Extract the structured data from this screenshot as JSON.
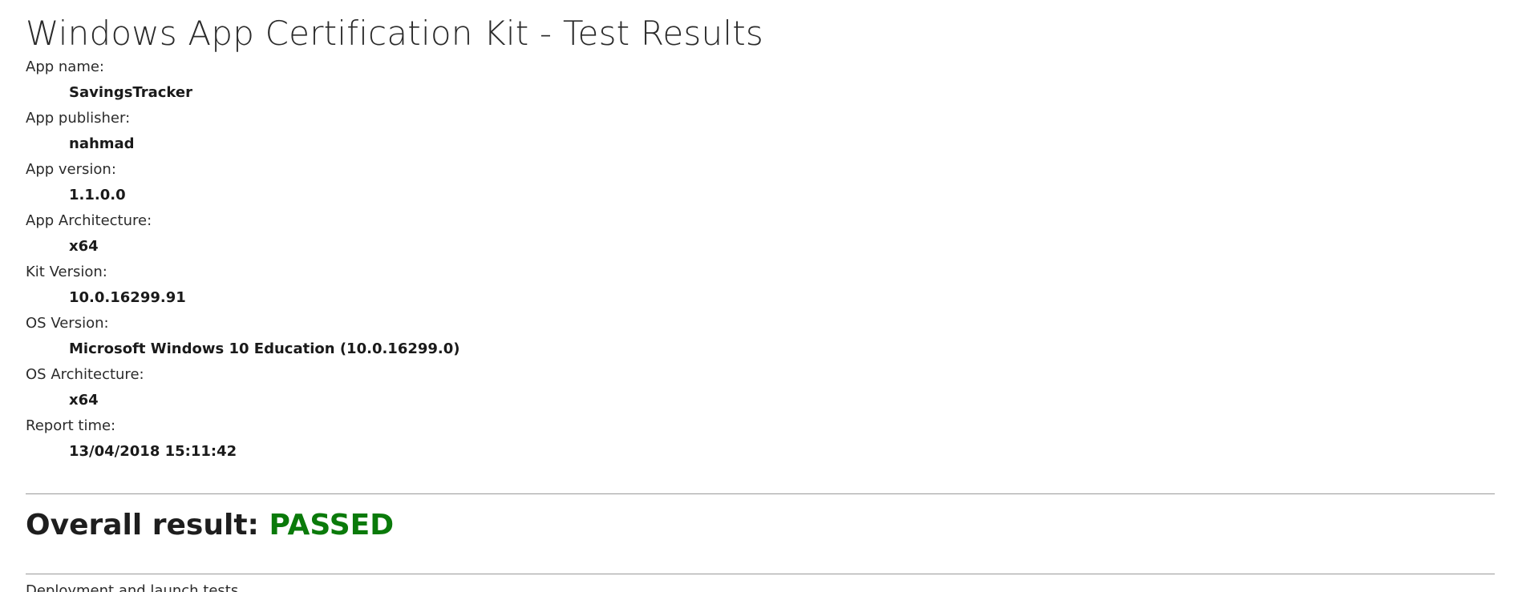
{
  "report": {
    "title": "Windows App Certification Kit - Test Results"
  },
  "details": [
    {
      "label": "App name:",
      "value": "SavingsTracker"
    },
    {
      "label": "App publisher:",
      "value": "nahmad"
    },
    {
      "label": "App version:",
      "value": "1.1.0.0"
    },
    {
      "label": "App Architecture:",
      "value": "x64"
    },
    {
      "label": "Kit Version:",
      "value": "10.0.16299.91"
    },
    {
      "label": "OS Version:",
      "value": "Microsoft Windows 10 Education (10.0.16299.0)"
    },
    {
      "label": "OS Architecture:",
      "value": "x64"
    },
    {
      "label": "Report time:",
      "value": "13/04/2018 15:11:42"
    }
  ],
  "overall": {
    "label": "Overall result:",
    "status": "PASSED",
    "status_color": "#0a7a0a"
  },
  "cut_off_text": "Deployment and launch tests"
}
